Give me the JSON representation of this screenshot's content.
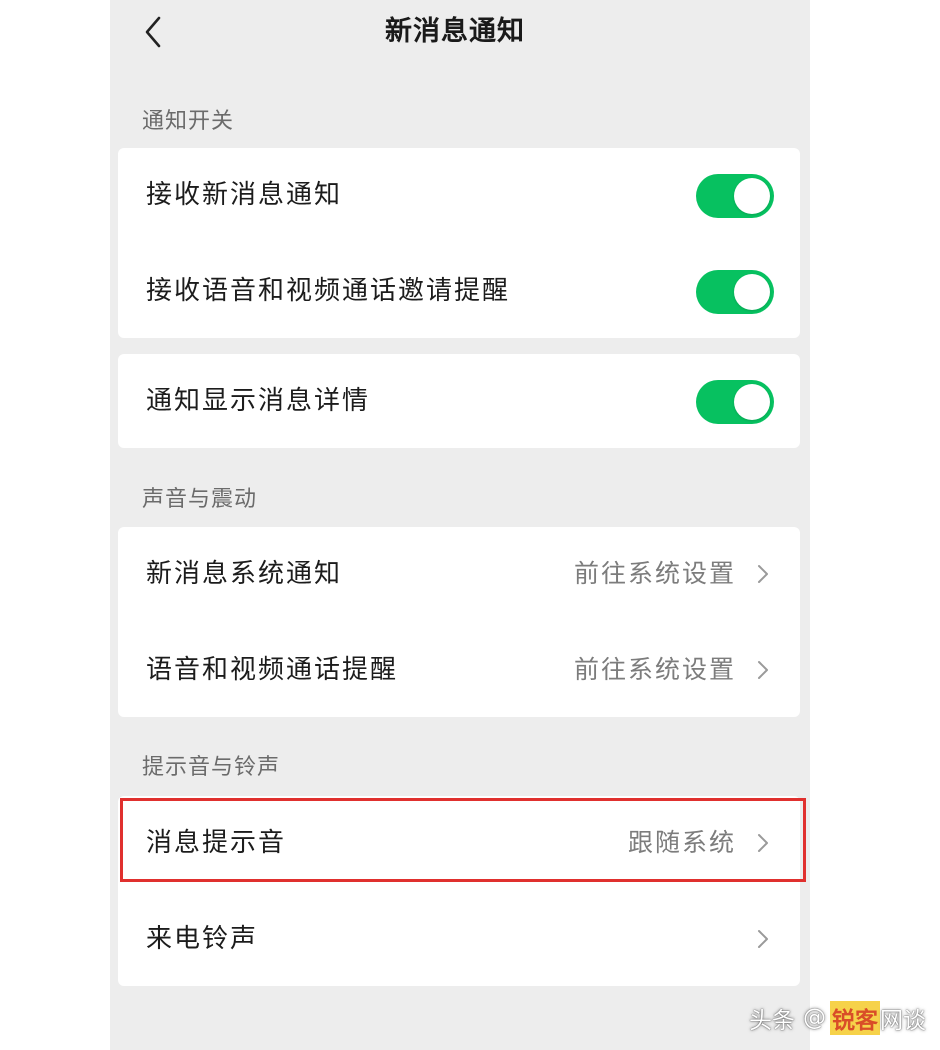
{
  "nav": {
    "title": "新消息通知",
    "back_icon": "chevron-left-icon"
  },
  "sections": {
    "notify_switch": {
      "header": "通知开关",
      "items": [
        {
          "label": "接收新消息通知",
          "toggle_on": true
        },
        {
          "label": "接收语音和视频通话邀请提醒",
          "toggle_on": true
        }
      ],
      "detail_item": {
        "label": "通知显示消息详情",
        "toggle_on": true
      }
    },
    "sound_vibration": {
      "header": "声音与震动",
      "items": [
        {
          "label": "新消息系统通知",
          "value": "前往系统设置"
        },
        {
          "label": "语音和视频通话提醒",
          "value": "前往系统设置"
        }
      ]
    },
    "ringtones": {
      "header": "提示音与铃声",
      "items": [
        {
          "label": "消息提示音",
          "value": "跟随系统",
          "highlighted": true
        },
        {
          "label": "来电铃声",
          "value": ""
        }
      ]
    }
  },
  "watermark": {
    "source": "头条",
    "at": "@",
    "brand": "锐客",
    "suffix": "网谈"
  },
  "colors": {
    "toggle_on": "#07c160",
    "page_bg": "#ededed",
    "highlight_border": "#e0302e"
  }
}
